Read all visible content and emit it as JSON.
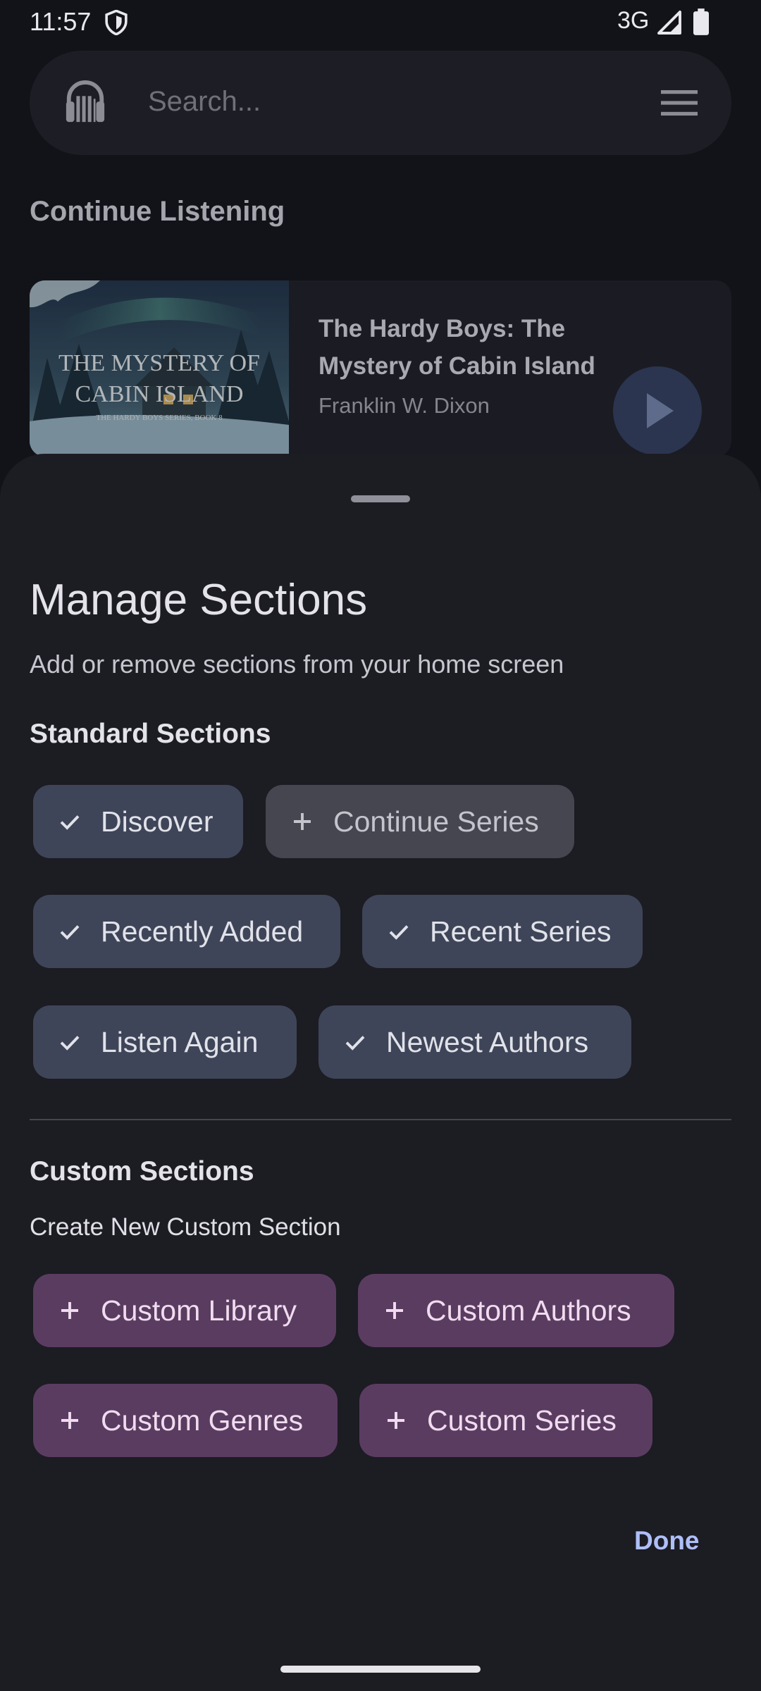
{
  "status_bar": {
    "time": "11:57",
    "network": "3G"
  },
  "search": {
    "placeholder": "Search..."
  },
  "continue_listening": {
    "title": "Continue Listening",
    "book": {
      "title": "The Hardy Boys: The Mystery of Cabin Island",
      "author": "Franklin W. Dixon",
      "cover_text_line1": "THE MYSTERY OF",
      "cover_text_line2": "CABIN ISLAND",
      "cover_text_line3": "THE HARDY BOYS SERIES, BOOK 8"
    }
  },
  "sheet": {
    "title": "Manage Sections",
    "subtitle": "Add or remove sections from your home screen",
    "standard_label": "Standard Sections",
    "standard_chips": [
      {
        "label": "Discover",
        "selected": true
      },
      {
        "label": "Continue Series",
        "selected": false
      },
      {
        "label": "Recently Added",
        "selected": true
      },
      {
        "label": "Recent Series",
        "selected": true
      },
      {
        "label": "Listen Again",
        "selected": true
      },
      {
        "label": "Newest Authors",
        "selected": true
      }
    ],
    "custom_label": "Custom Sections",
    "create_label": "Create New Custom Section",
    "custom_chips": [
      {
        "label": "Custom Library"
      },
      {
        "label": "Custom Authors"
      },
      {
        "label": "Custom Genres"
      },
      {
        "label": "Custom Series"
      }
    ],
    "done_label": "Done"
  },
  "colors": {
    "background": "#121318",
    "sheet": "#1c1c23",
    "chip_selected": "#3f4558",
    "chip_unselected": "#45464f",
    "chip_custom": "#5b3c61",
    "accent": "#aebff8"
  }
}
